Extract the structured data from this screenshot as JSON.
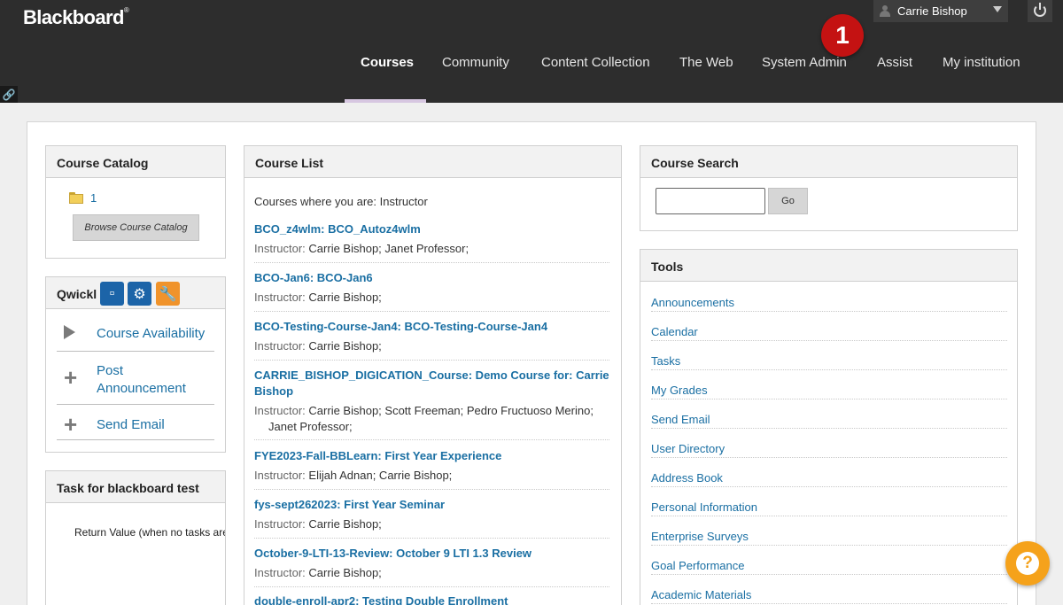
{
  "header": {
    "brand": "Blackboard",
    "user_name": "Carrie Bishop",
    "step_badge": "1",
    "tabs": [
      {
        "label": "Courses"
      },
      {
        "label": "Community"
      },
      {
        "label": "Content Collection"
      },
      {
        "label": "The Web"
      },
      {
        "label": "System Admin"
      },
      {
        "label": "Assist"
      },
      {
        "label": "My institution"
      }
    ]
  },
  "course_catalog": {
    "title": "Course Catalog",
    "folder_link": "1",
    "browse_button": "Browse Course Catalog"
  },
  "qwickly": {
    "title": "Qwickl",
    "items": [
      {
        "label": "Course Availability"
      },
      {
        "label": "Post Announcement"
      },
      {
        "label": "Send Email"
      }
    ]
  },
  "task": {
    "title": "Task for blackboard test",
    "text": "Return Value (when no tasks are"
  },
  "course_list": {
    "title": "Course List",
    "intro": "Courses where you are: Instructor",
    "instructor_label": "Instructor:",
    "courses": [
      {
        "title": "BCO_z4wlm: BCO_Autoz4wlm",
        "instructors": "Carrie Bishop;  Janet Professor;"
      },
      {
        "title": "BCO-Jan6: BCO-Jan6",
        "instructors": "Carrie Bishop;"
      },
      {
        "title": "BCO-Testing-Course-Jan4: BCO-Testing-Course-Jan4",
        "instructors": "Carrie Bishop;"
      },
      {
        "title": "CARRIE_BISHOP_DIGICATION_Course: Demo Course for: Carrie Bishop",
        "instructors": "Carrie Bishop;  Scott Freeman;  Pedro Fructuoso Merino;  Janet Professor;"
      },
      {
        "title": "FYE2023-Fall-BBLearn: First Year Experience",
        "instructors": "Elijah Adnan;  Carrie Bishop;"
      },
      {
        "title": "fys-sept262023: First Year Seminar",
        "instructors": "Carrie Bishop;"
      },
      {
        "title": "October-9-LTI-13-Review: October 9 LTI 1.3 Review",
        "instructors": "Carrie Bishop;"
      },
      {
        "title": "double-enroll-apr2: Testing Double Enrollment",
        "instructors": ""
      }
    ]
  },
  "course_search": {
    "title": "Course Search",
    "go_button": "Go"
  },
  "tools": {
    "title": "Tools",
    "items": [
      {
        "label": "Announcements"
      },
      {
        "label": "Calendar"
      },
      {
        "label": "Tasks"
      },
      {
        "label": "My Grades"
      },
      {
        "label": "Send Email"
      },
      {
        "label": "User Directory"
      },
      {
        "label": "Address Book"
      },
      {
        "label": "Personal Information"
      },
      {
        "label": "Enterprise Surveys"
      },
      {
        "label": "Goal Performance"
      },
      {
        "label": "Academic Materials"
      }
    ]
  },
  "help": {
    "symbol": "?"
  },
  "icons": {
    "link": "link-icon",
    "power": "power-icon",
    "user": "user-icon",
    "help": "question-icon"
  },
  "colors": {
    "header_bg": "#2d2d2d",
    "link": "#1a6fa3",
    "badge": "#c41212",
    "help": "#f5a21b",
    "qwickly_blue": "#1c64a8",
    "qwickly_orange": "#f0932b"
  }
}
